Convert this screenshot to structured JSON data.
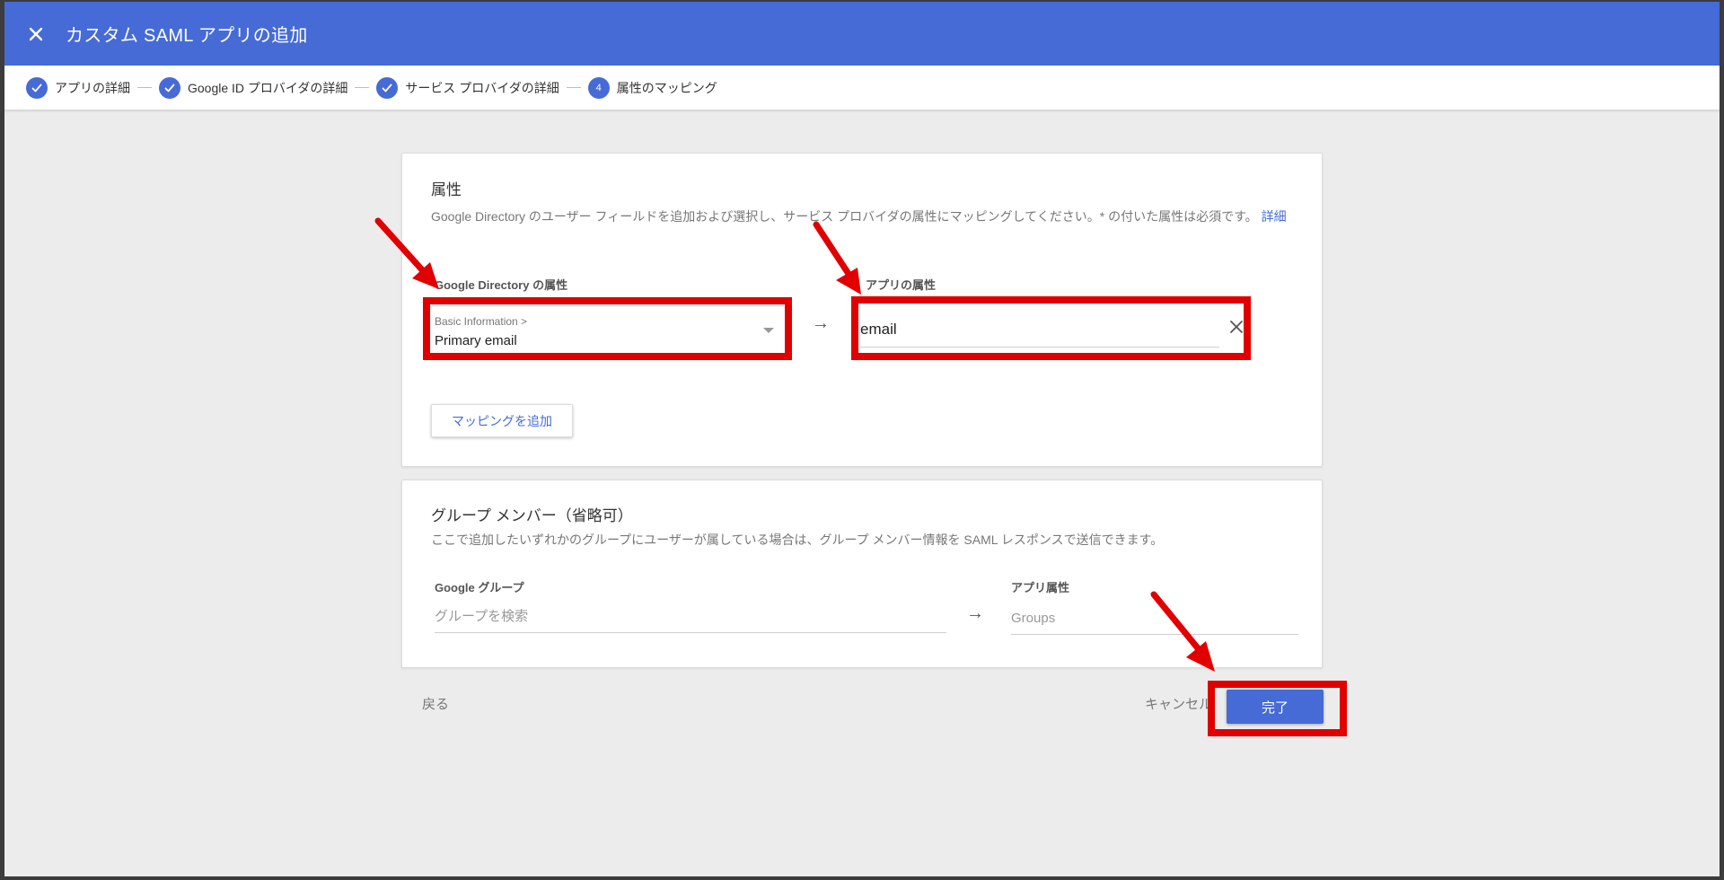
{
  "header": {
    "title": "カスタム SAML アプリの追加"
  },
  "stepper": {
    "steps": [
      {
        "label": "アプリの詳細",
        "state": "done"
      },
      {
        "label": "Google ID プロバイダの詳細",
        "state": "done"
      },
      {
        "label": "サービス プロバイダの詳細",
        "state": "done"
      },
      {
        "label": "属性のマッピング",
        "state": "active",
        "number": "4"
      }
    ]
  },
  "attributes": {
    "title": "属性",
    "description": "Google Directory のユーザー フィールドを追加および選択し、サービス プロバイダの属性にマッピングしてください。* の付いた属性は必須です。",
    "link": "詳細",
    "directory_label": "Google Directory の属性",
    "app_label": "アプリの属性",
    "select_category": "Basic Information >",
    "select_value": "Primary email",
    "app_value": "email",
    "add_button": "マッピングを追加",
    "arrow": "→"
  },
  "groups": {
    "title": "グループ メンバー（省略可）",
    "description": "ここで追加したいずれかのグループにユーザーが属している場合は、グループ メンバー情報を SAML レスポンスで送信できます。",
    "google_group_label": "Google グループ",
    "app_attr_label": "アプリ属性",
    "search_placeholder": "グループを検索",
    "app_attr_placeholder": "Groups",
    "arrow": "→"
  },
  "footer": {
    "back": "戻る",
    "cancel": "キャンセル",
    "done": "完了"
  },
  "colors": {
    "accent": "#466bd6",
    "annotation": "#e10000",
    "background": "#ececec"
  }
}
